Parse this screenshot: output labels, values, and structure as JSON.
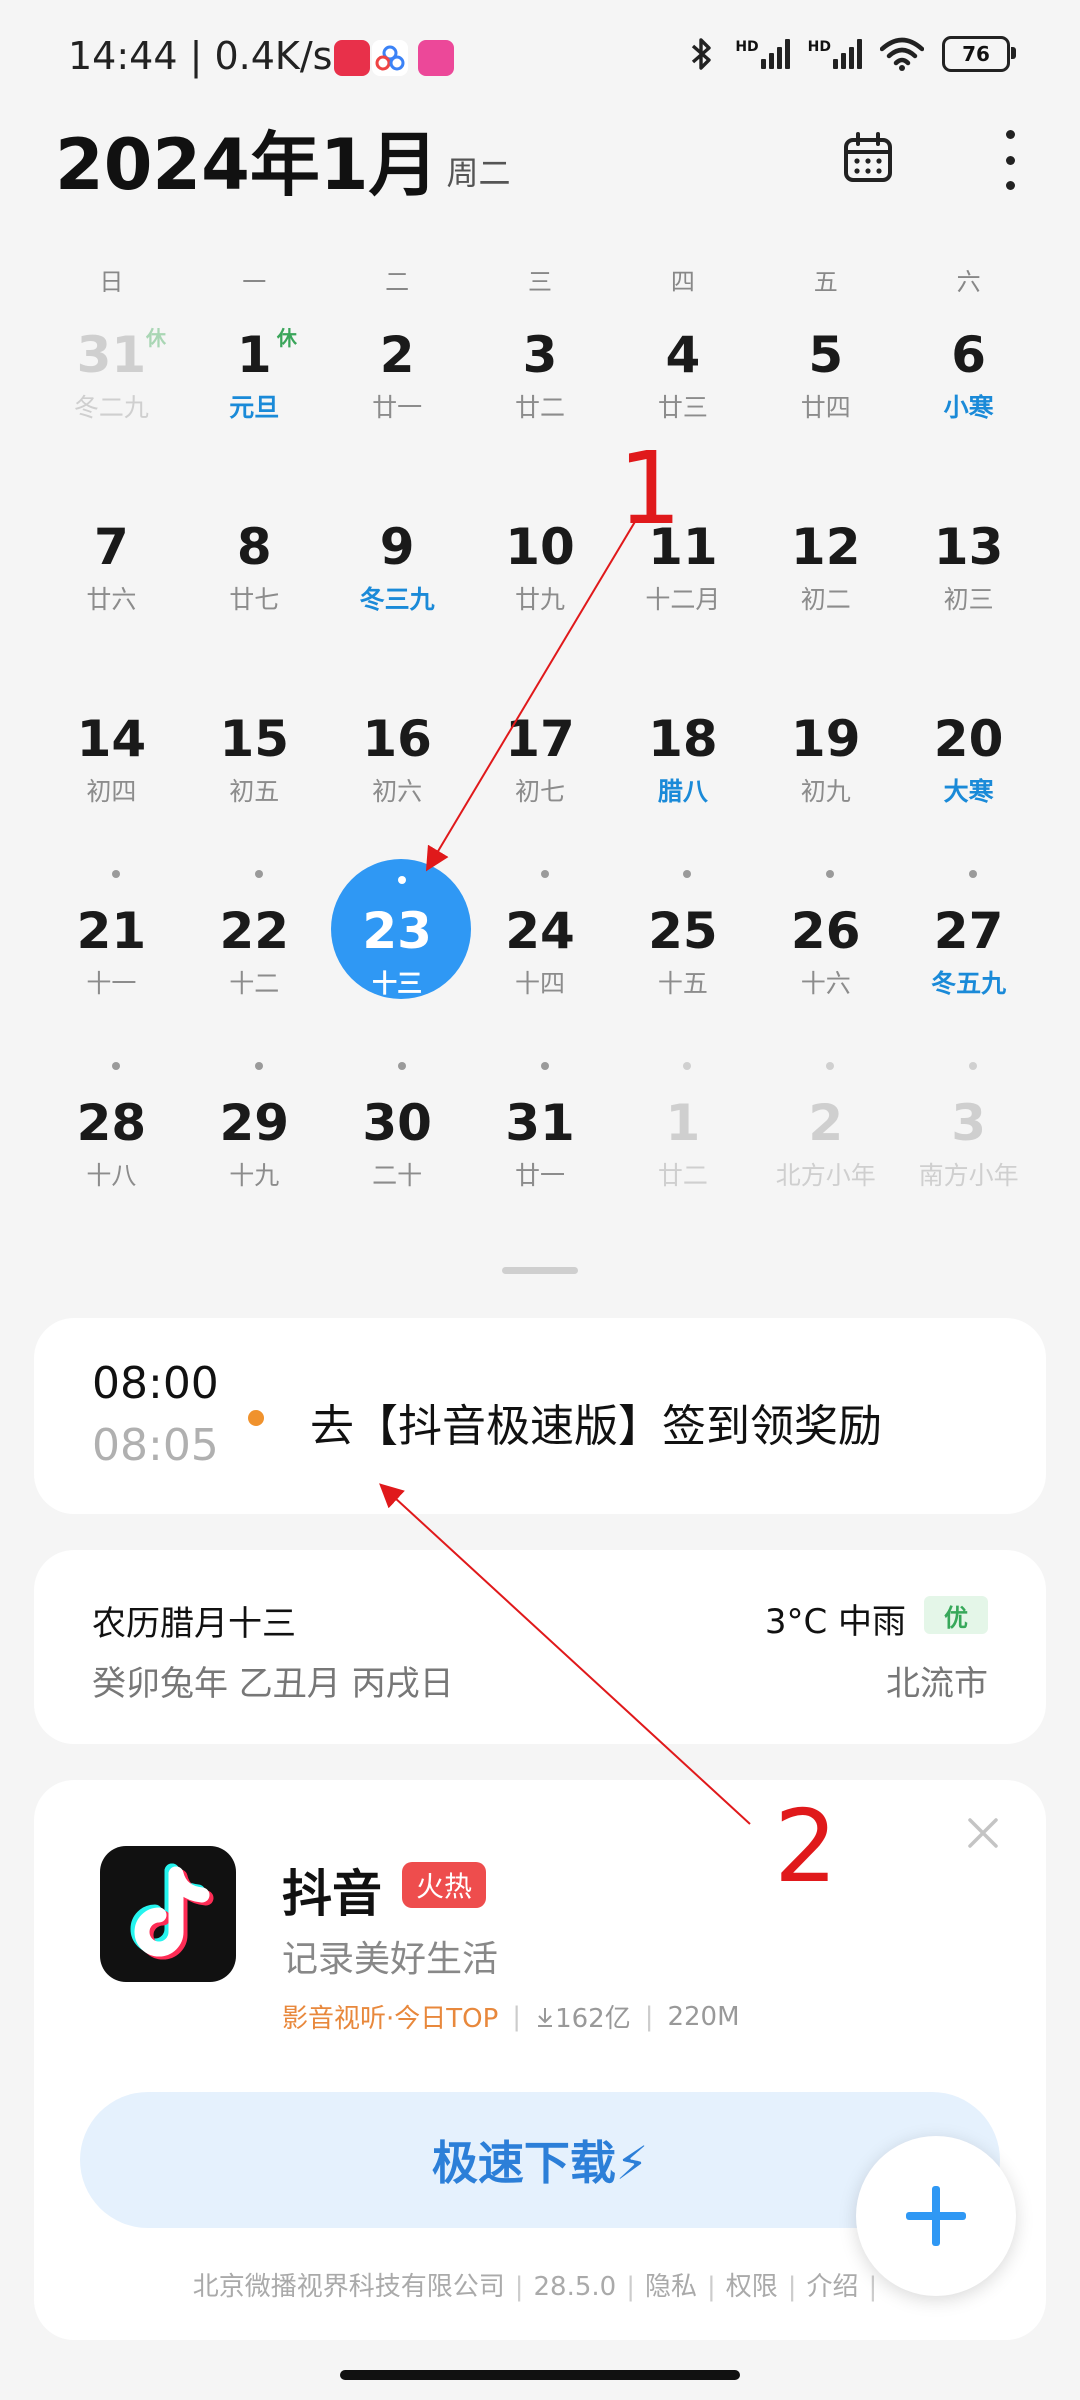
{
  "status_bar": {
    "time": "14:44",
    "speed": "0.4K/s",
    "battery": "76",
    "hd_label": "HD"
  },
  "header": {
    "title": "2024年1月",
    "weekday": "周二"
  },
  "weekdays": [
    "日",
    "一",
    "二",
    "三",
    "四",
    "五",
    "六"
  ],
  "calendar": {
    "weeks": [
      [
        {
          "day": "31",
          "lunar": "冬二九",
          "faded": true,
          "rest": "休"
        },
        {
          "day": "1",
          "lunar": "元旦",
          "blue": true,
          "rest": "休"
        },
        {
          "day": "2",
          "lunar": "廿一"
        },
        {
          "day": "3",
          "lunar": "廿二"
        },
        {
          "day": "4",
          "lunar": "廿三"
        },
        {
          "day": "5",
          "lunar": "廿四"
        },
        {
          "day": "6",
          "lunar": "小寒",
          "blue": true
        }
      ],
      [
        {
          "day": "7",
          "lunar": "廿六"
        },
        {
          "day": "8",
          "lunar": "廿七"
        },
        {
          "day": "9",
          "lunar": "冬三九",
          "blue": true
        },
        {
          "day": "10",
          "lunar": "廿九"
        },
        {
          "day": "11",
          "lunar": "十二月"
        },
        {
          "day": "12",
          "lunar": "初二"
        },
        {
          "day": "13",
          "lunar": "初三"
        }
      ],
      [
        {
          "day": "14",
          "lunar": "初四"
        },
        {
          "day": "15",
          "lunar": "初五"
        },
        {
          "day": "16",
          "lunar": "初六"
        },
        {
          "day": "17",
          "lunar": "初七"
        },
        {
          "day": "18",
          "lunar": "腊八",
          "blue": true
        },
        {
          "day": "19",
          "lunar": "初九"
        },
        {
          "day": "20",
          "lunar": "大寒",
          "blue": true
        }
      ],
      [
        {
          "day": "21",
          "lunar": "十一",
          "dot": true
        },
        {
          "day": "22",
          "lunar": "十二",
          "dot": true
        },
        {
          "day": "23",
          "lunar": "十三",
          "dot": true,
          "selected": true
        },
        {
          "day": "24",
          "lunar": "十四",
          "dot": true
        },
        {
          "day": "25",
          "lunar": "十五",
          "dot": true
        },
        {
          "day": "26",
          "lunar": "十六",
          "dot": true
        },
        {
          "day": "27",
          "lunar": "冬五九",
          "dot": true,
          "blue": true
        }
      ],
      [
        {
          "day": "28",
          "lunar": "十八",
          "dot": true
        },
        {
          "day": "29",
          "lunar": "十九",
          "dot": true
        },
        {
          "day": "30",
          "lunar": "二十",
          "dot": true
        },
        {
          "day": "31",
          "lunar": "廿一",
          "dot": true
        },
        {
          "day": "1",
          "lunar": "廿二",
          "dot": true,
          "faded": true
        },
        {
          "day": "2",
          "lunar": "北方小年",
          "dot": true,
          "faded": true
        },
        {
          "day": "3",
          "lunar": "南方小年",
          "dot": true,
          "faded": true
        }
      ]
    ]
  },
  "event": {
    "start": "08:00",
    "end": "08:05",
    "title": "去【抖音极速版】签到领奖励",
    "dot_color": "#f0922d"
  },
  "info": {
    "lunar_date": "农历腊月十三",
    "ganzhi": "癸卯兔年 乙丑月 丙戌日",
    "weather": "3°C 中雨",
    "aqi": "优",
    "city": "北流市"
  },
  "ad": {
    "app_name": "抖音",
    "hot_badge": "火热",
    "slogan": "记录美好生活",
    "category": "影音视听·今日TOP",
    "downloads": "162亿",
    "size": "220M",
    "download_button": "极速下载⚡",
    "developer": "北京微播视界科技有限公司",
    "version": "28.5.0",
    "privacy": "隐私",
    "permissions": "权限",
    "intro": "介绍"
  },
  "annotations": {
    "label_1": "1",
    "label_2": "2"
  },
  "colors": {
    "accent": "#2f98f4",
    "lunar_highlight": "#1a8ad8",
    "annotation": "#e0191b"
  }
}
